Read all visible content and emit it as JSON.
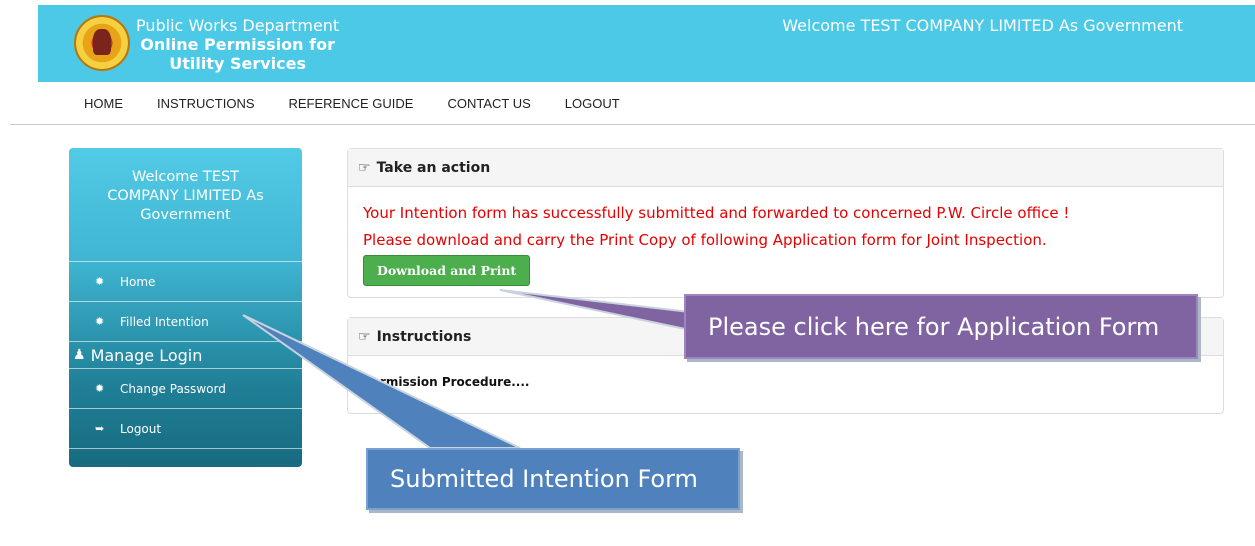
{
  "header": {
    "line1": "Public Works Department",
    "line2": "Online Permission for",
    "line3": "Utility Services",
    "welcome": "Welcome TEST COMPANY LIMITED As Government"
  },
  "nav": [
    "HOME",
    "INSTRUCTIONS",
    "REFERENCE GUIDE",
    "CONTACT US",
    "LOGOUT"
  ],
  "sidebar": {
    "welcome": "Welcome TEST COMPANY LIMITED As Government",
    "items": [
      {
        "label": "Home",
        "icon": "gear-icon"
      },
      {
        "label": "Filled Intention",
        "icon": "gear-icon"
      },
      {
        "label": "Change Password",
        "icon": "gear-icon"
      },
      {
        "label": "Logout",
        "icon": "sign-out-icon"
      }
    ],
    "section": "Manage Login"
  },
  "action_panel": {
    "title": "Take an action",
    "message1": "Your Intention form has successfully submitted and forwarded to concerned P.W. Circle office !",
    "message2": "Please download and carry the Print Copy of following Application form for Joint Inspection.",
    "button": "Download and Print"
  },
  "instructions_panel": {
    "title": "Instructions",
    "text": "Permission Procedure...."
  },
  "callouts": {
    "application": "Please click here for Application Form",
    "intention": "Submitted Intention Form"
  },
  "colors": {
    "header": "#4bc9e6",
    "button": "#4cae4c",
    "message": "#e60000",
    "callout_purple": "#8064a2",
    "callout_blue": "#4f81bd"
  }
}
